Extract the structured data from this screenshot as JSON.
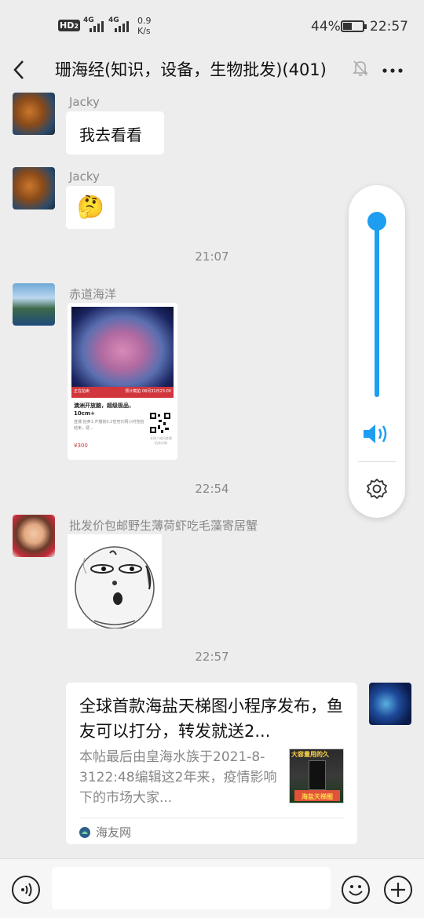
{
  "status_bar": {
    "hd": "HD",
    "hd_sub": "2",
    "net1": "4G",
    "net2": "4G",
    "speed_value": "0.9",
    "speed_unit": "K/s",
    "battery": "44%",
    "battery_level": 0.44,
    "time": "22:57"
  },
  "header": {
    "back_icon": "chevron-left-icon",
    "title": "珊海经(知识，设备，生物批发)(401)",
    "mute_icon": "bell-off-icon",
    "more_icon": "more-icon"
  },
  "messages": [
    {
      "sender": "Jacky",
      "text": "我去看看"
    },
    {
      "sender": "Jacky",
      "emoji": "🤔"
    },
    {
      "time": "21:07"
    },
    {
      "sender": "赤道海洋",
      "product_card": {
        "badge_left": "正在拍卖",
        "badge_right": "预计截拍 08月31日23:00",
        "product_title": "澳洲开放脑，超级极品，10cm+",
        "product_desc": "直播 拍卖1.开播前0.2倍竞价网小时竞拍结束，便...",
        "price": "¥300",
        "qr_caption": "长按二维码查看拍卖详情"
      }
    },
    {
      "time": "22:54"
    },
    {
      "sender": "批发价包邮野生薄荷虾吃毛藻寄居蟹",
      "sticker": "meme-sticker"
    },
    {
      "time": "22:57"
    },
    {
      "link_card": {
        "title": "全球首款海盐天梯图小程序发布，鱼友可以打分，转发就送2...",
        "desc": "本帖最后由皇海水族于2021-8-3122:48编辑这2年来，疫情影响下的市场大家...",
        "thumb_top_text": "大容量用的久",
        "thumb_bottom_text": "海盐天梯图",
        "source": "海友网"
      }
    }
  ],
  "volume_panel": {
    "level": 0.95,
    "speaker_icon": "speaker-icon",
    "settings_icon": "settings-icon"
  },
  "input_bar": {
    "voice_icon": "voice-icon",
    "emoji_icon": "emoji-icon",
    "add_icon": "add-icon",
    "input_value": ""
  },
  "colors": {
    "bg": "#ededed",
    "accent": "#1e9ef0",
    "red": "#d1363c"
  }
}
